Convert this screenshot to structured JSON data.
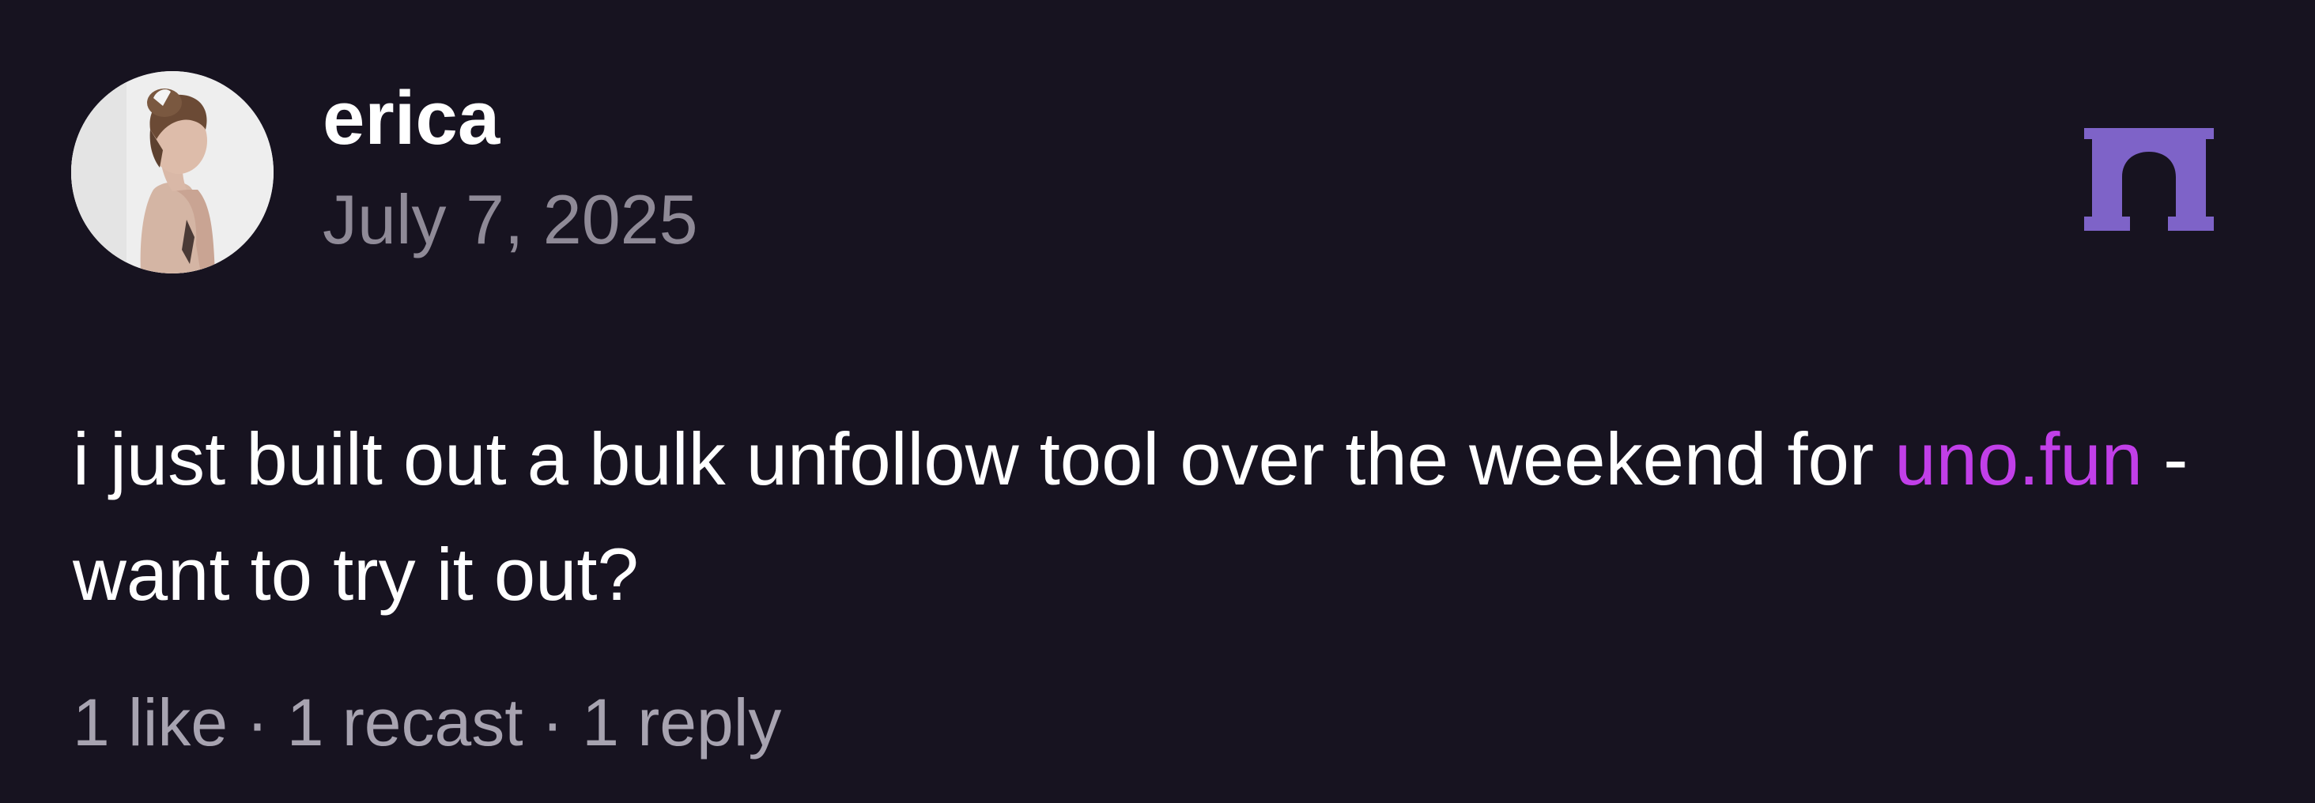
{
  "post": {
    "author_name": "erica",
    "date": "July 7, 2025",
    "text_before_link": "i just built out a bulk unfollow tool over the weekend for ",
    "link_text": "uno.fun",
    "text_after_link": " - want to try it out?",
    "likes": "1 like",
    "recasts": "1 recast",
    "replies": "1 reply",
    "separator": " · "
  },
  "brand": {
    "icon": "arch-icon",
    "color": "#7e63c8"
  },
  "colors": {
    "background": "#171320",
    "link": "#c13fe8",
    "muted": "#8f8a97"
  }
}
